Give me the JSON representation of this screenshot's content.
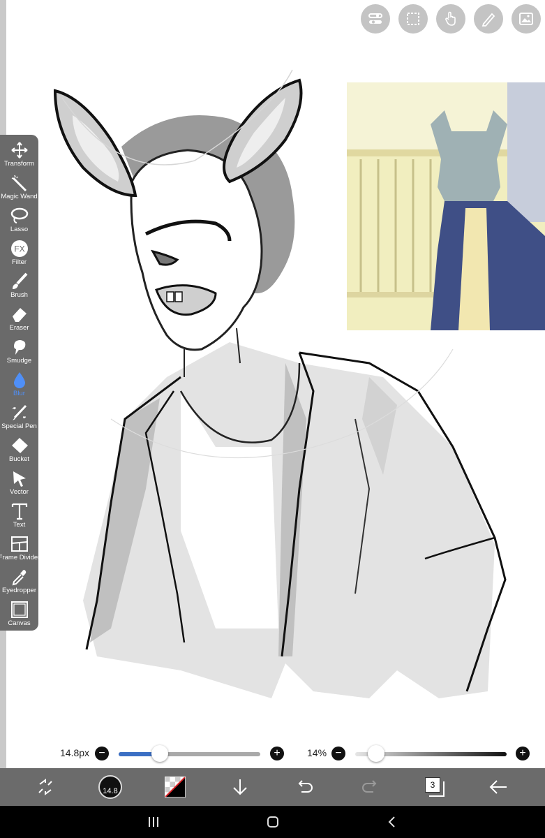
{
  "app": {
    "accent_color": "#4f8ff7",
    "toolbar_bg": "#6a6a6a"
  },
  "top_actions": [
    {
      "name": "layer-settings-icon"
    },
    {
      "name": "selection-icon"
    },
    {
      "name": "hand-gesture-icon"
    },
    {
      "name": "ruler-pen-icon"
    },
    {
      "name": "image-material-icon"
    }
  ],
  "tools": [
    {
      "label": "Transform",
      "icon": "transform-icon"
    },
    {
      "label": "Magic Wand",
      "icon": "magic-wand-icon"
    },
    {
      "label": "Lasso",
      "icon": "lasso-icon"
    },
    {
      "label": "Filter",
      "icon": "fx-icon"
    },
    {
      "label": "Brush",
      "icon": "brush-icon"
    },
    {
      "label": "Eraser",
      "icon": "eraser-icon"
    },
    {
      "label": "Smudge",
      "icon": "smudge-icon"
    },
    {
      "label": "Blur",
      "icon": "blur-drop-icon",
      "active": true
    },
    {
      "label": "Special Pen",
      "icon": "special-pen-icon"
    },
    {
      "label": "Bucket",
      "icon": "bucket-icon"
    },
    {
      "label": "Vector",
      "icon": "vector-arrow-icon"
    },
    {
      "label": "Text",
      "icon": "text-icon"
    },
    {
      "label": "Frame Divider",
      "icon": "frame-divider-icon"
    },
    {
      "label": "Eyedropper",
      "icon": "eyedropper-icon"
    },
    {
      "label": "Canvas",
      "icon": "canvas-icon"
    }
  ],
  "sliders": {
    "size": {
      "label": "14.8px",
      "minus": "−",
      "plus": "+",
      "value_fraction": 0.29
    },
    "opacity": {
      "label": "14%",
      "minus": "−",
      "plus": "+",
      "value_fraction": 0.14
    }
  },
  "bottom_bar": {
    "brush_size_label": "14.8",
    "layer_count": "3"
  }
}
